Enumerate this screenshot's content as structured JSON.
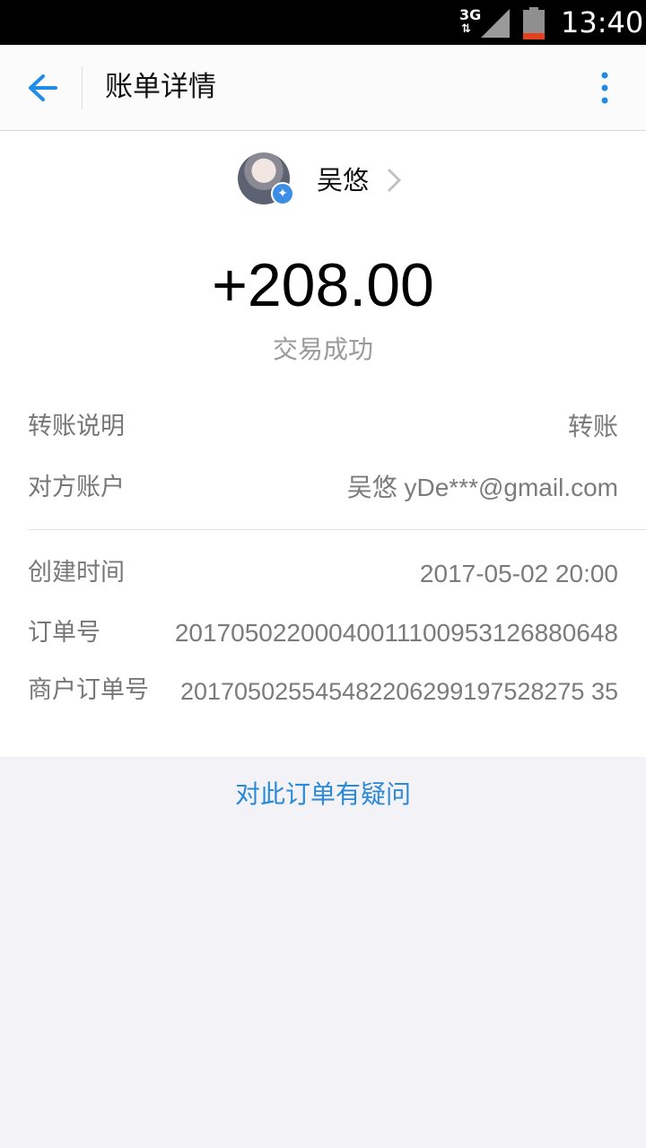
{
  "status_bar": {
    "network": "3G",
    "time": "13:40"
  },
  "app_bar": {
    "title": "账单详情",
    "back_icon": "arrow-left-icon",
    "more_icon": "more-vertical-icon"
  },
  "contact": {
    "name": "吴悠",
    "verified_icon": "verified-badge-icon"
  },
  "transaction": {
    "amount": "+208.00",
    "status": "交易成功"
  },
  "details": [
    {
      "label": "转账说明",
      "value": "转账"
    },
    {
      "label": "对方账户",
      "value": "吴悠 yDe***@gmail.com"
    }
  ],
  "details2": [
    {
      "label": "创建时间",
      "value": "2017-05-02 20:00"
    },
    {
      "label": "订单号",
      "value": "20170502200040011100953126880648"
    },
    {
      "label": "商户订单号",
      "value": "201705025545482206299197528275 35"
    }
  ],
  "footer": {
    "question_link": "对此订单有疑问"
  },
  "colors": {
    "accent": "#2a8ad8",
    "battery_low": "#e5411e"
  }
}
